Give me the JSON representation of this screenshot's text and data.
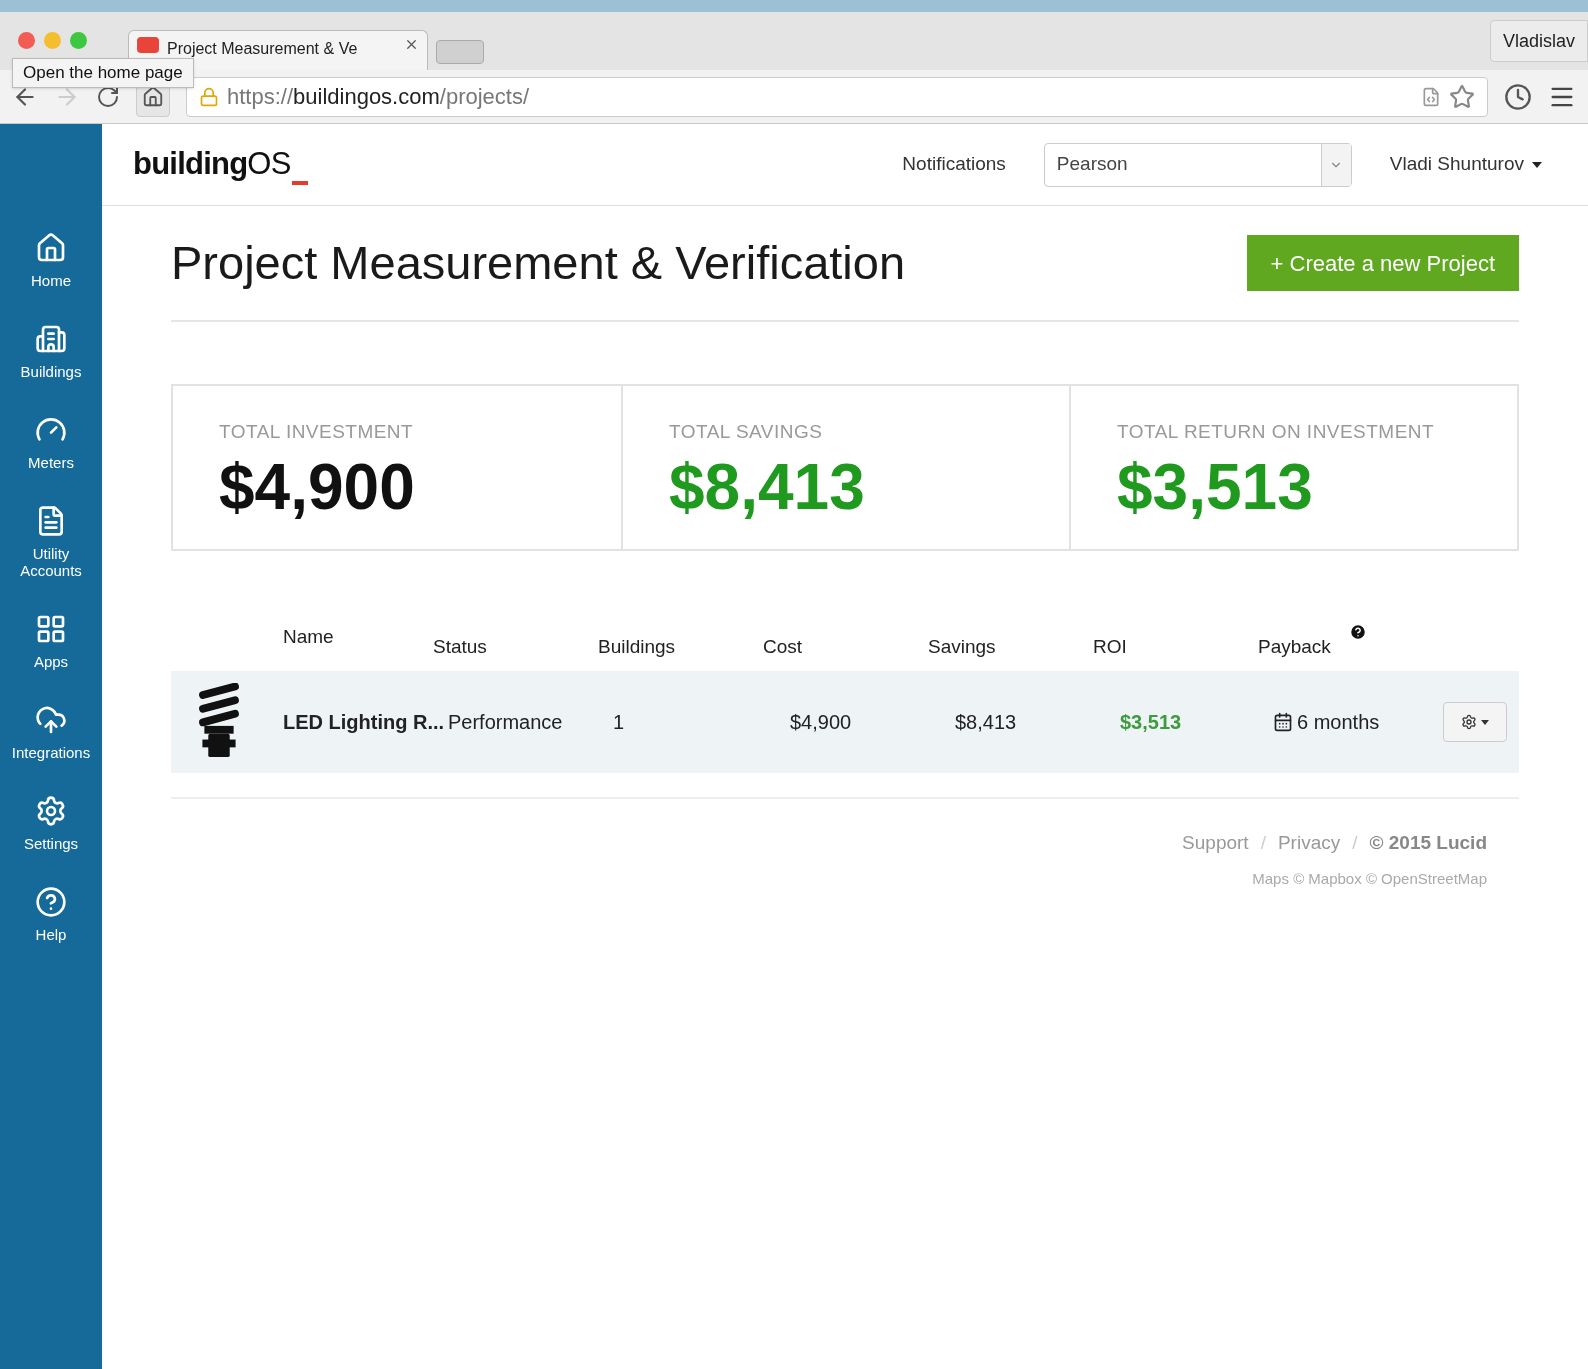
{
  "browser": {
    "tabs": [
      {
        "title": "Project Measurement & Ve",
        "selected": true
      }
    ],
    "tooltip": "Open the home page",
    "url": {
      "scheme": "https://",
      "host": "buildingos.com",
      "path": "/projects/"
    },
    "profile": "Vladislav"
  },
  "sidebar": {
    "items": [
      {
        "label": "Home"
      },
      {
        "label": "Buildings"
      },
      {
        "label": "Meters"
      },
      {
        "label": "Utility Accounts"
      },
      {
        "label": "Apps"
      },
      {
        "label": "Integrations"
      },
      {
        "label": "Settings"
      },
      {
        "label": "Help"
      }
    ]
  },
  "header": {
    "logo": {
      "bold": "building",
      "light": "OS"
    },
    "notifications": "Notifications",
    "organization": "Pearson",
    "user": "Vladi Shunturov"
  },
  "page": {
    "title": "Project Measurement & Verification",
    "create_button": "+ Create a new Project"
  },
  "stats": [
    {
      "label": "TOTAL INVESTMENT",
      "value": "$4,900",
      "color": "#111111"
    },
    {
      "label": "TOTAL SAVINGS",
      "value": "$8,413",
      "color": "#1f9a1f"
    },
    {
      "label": "TOTAL RETURN ON INVESTMENT",
      "value": "$3,513",
      "color": "#1f9a1f"
    }
  ],
  "table": {
    "columns": [
      "Name",
      "Status",
      "Buildings",
      "Cost",
      "Savings",
      "ROI",
      "Payback"
    ],
    "rows": [
      {
        "name": "LED Lighting R...",
        "status": "Performance",
        "buildings": "1",
        "cost": "$4,900",
        "savings": "$8,413",
        "roi": "$3,513",
        "payback": "6 months"
      }
    ]
  },
  "footer": {
    "links": [
      "Support",
      "Privacy"
    ],
    "separators": [
      "/",
      "/"
    ],
    "copyright": "© 2015 Lucid",
    "attribution": "Maps © Mapbox © OpenStreetMap"
  }
}
